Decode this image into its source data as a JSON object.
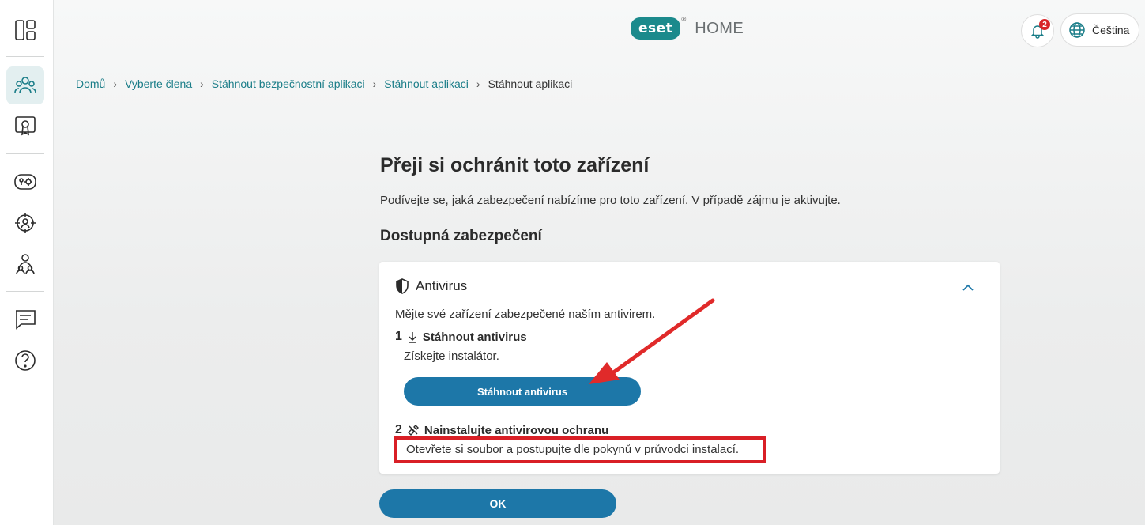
{
  "header": {
    "logo_text": "eset",
    "logo_suffix": "HOME",
    "registered_mark": "®",
    "notification_count": "2",
    "language_label": "Čeština"
  },
  "sidebar": {
    "items": [
      {
        "name": "dashboard",
        "icon": "dashboard-icon",
        "active": false
      },
      {
        "name": "members",
        "icon": "members-icon",
        "active": true
      },
      {
        "name": "licenses",
        "icon": "license-certificate-icon",
        "active": false
      },
      {
        "name": "password-manager",
        "icon": "password-manager-icon",
        "active": false
      },
      {
        "name": "anti-theft",
        "icon": "anti-theft-target-icon",
        "active": false
      },
      {
        "name": "parental-control",
        "icon": "parental-control-icon",
        "active": false
      },
      {
        "name": "feedback",
        "icon": "feedback-message-icon",
        "active": false
      },
      {
        "name": "help",
        "icon": "help-question-icon",
        "active": false
      }
    ]
  },
  "breadcrumb": {
    "items": [
      "Domů",
      "Vyberte člena",
      "Stáhnout bezpečnostní aplikaci",
      "Stáhnout aplikaci"
    ],
    "current": "Stáhnout aplikaci"
  },
  "main": {
    "title": "Přeji si ochránit toto zařízení",
    "description": "Podívejte se, jaká zabezpečení nabízíme pro toto zařízení. V případě zájmu je aktivujte.",
    "section_title": "Dostupná zabezpečení"
  },
  "card": {
    "title": "Antivirus",
    "description": "Mějte své zařízení zabezpečené naším antivirem.",
    "step1": {
      "number": "1",
      "title": "Stáhnout antivirus",
      "subtitle": "Získejte instalátor."
    },
    "download_button": "Stáhnout antivirus",
    "step2": {
      "number": "2",
      "title": "Nainstalujte antivirovou ochranu",
      "subtitle": "Otevřete si soubor a postupujte dle pokynů v průvodci instalací."
    }
  },
  "ok_button": "OK",
  "colors": {
    "accent": "#1d77a8",
    "brand": "#1b8a8c",
    "annotation_red": "#d91f26",
    "link": "#1a7d88"
  }
}
